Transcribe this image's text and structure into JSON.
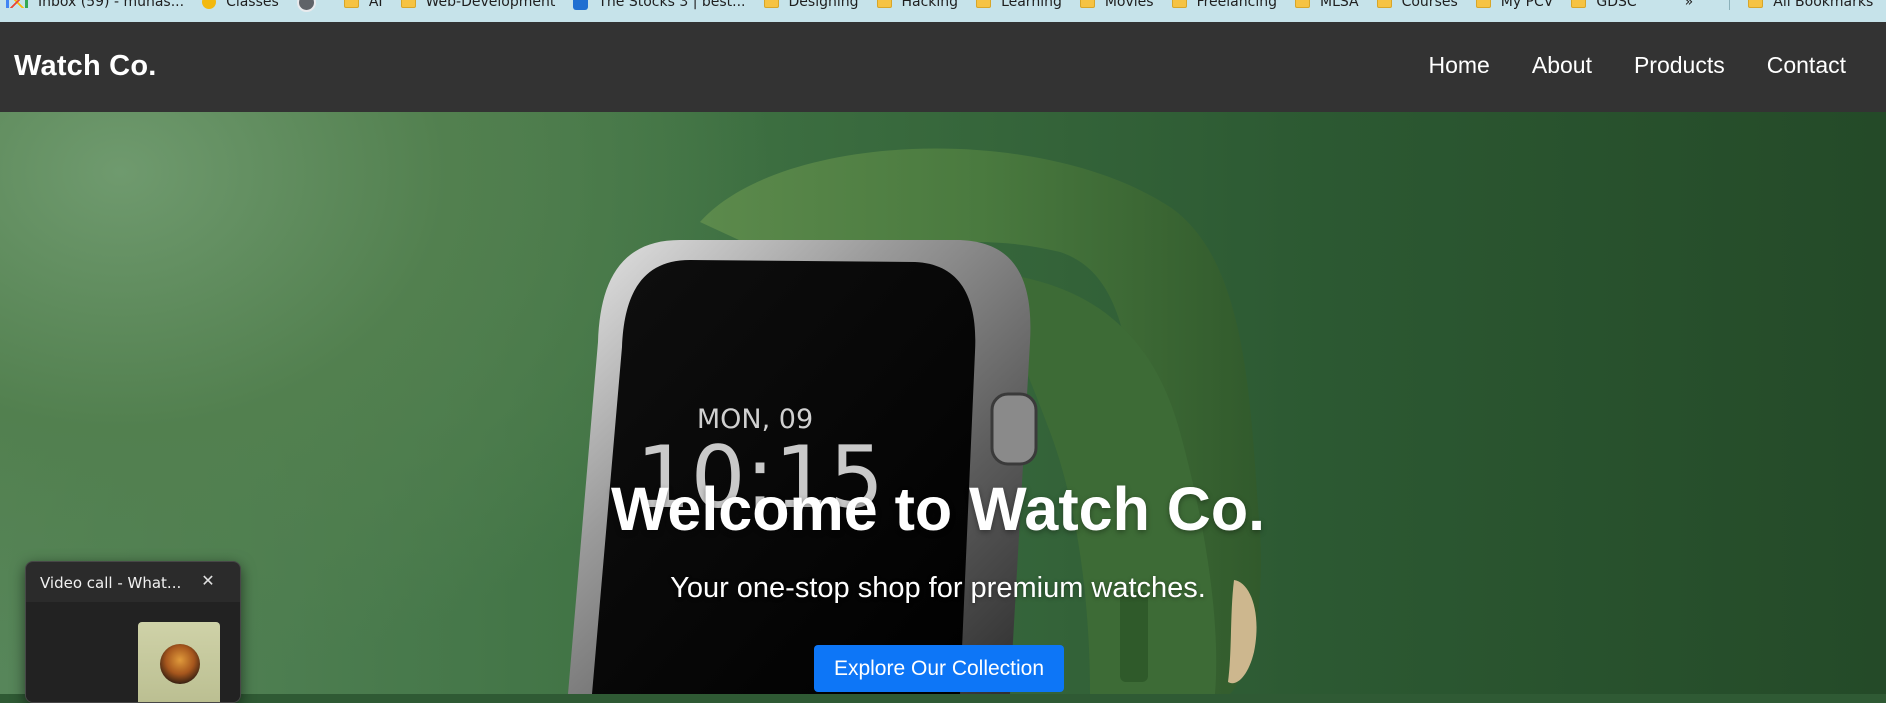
{
  "bookmarks": [
    {
      "label": "Inbox (59) - muhas...",
      "icon": "gmail-icon"
    },
    {
      "label": "Classes",
      "icon": "classes-icon"
    },
    {
      "label": "",
      "icon": "github-icon"
    },
    {
      "label": "AI",
      "icon": "folder-icon"
    },
    {
      "label": "Web-Development",
      "icon": "folder-icon"
    },
    {
      "label": "The Stocks 3 | best...",
      "icon": "stocks-icon"
    },
    {
      "label": "Designing",
      "icon": "folder-icon"
    },
    {
      "label": "Hacking",
      "icon": "folder-icon"
    },
    {
      "label": "Learning",
      "icon": "folder-icon"
    },
    {
      "label": "Movies",
      "icon": "folder-icon"
    },
    {
      "label": "Freelancing",
      "icon": "folder-icon"
    },
    {
      "label": "MLSA",
      "icon": "folder-icon"
    },
    {
      "label": "Courses",
      "icon": "folder-icon"
    },
    {
      "label": "My PCV",
      "icon": "folder-icon"
    },
    {
      "label": "GDSC",
      "icon": "folder-icon"
    }
  ],
  "bookmarks_overflow": "»",
  "all_bookmarks": "All Bookmarks",
  "header": {
    "logo": "Watch Co.",
    "nav": {
      "home": "Home",
      "about": "About",
      "products": "Products",
      "contact": "Contact"
    }
  },
  "hero": {
    "watch_date": "MON, 09",
    "watch_time": "10:15",
    "title": "Welcome to Watch Co.",
    "subtitle": "Your one-stop shop for premium watches.",
    "cta": "Explore Our Collection"
  },
  "video_call": {
    "title": "Video call - What...",
    "close": "✕"
  },
  "colors": {
    "header_bg": "#333333",
    "cta_bg": "#0d76f7",
    "bookmark_bar_bg": "#c6e3ea",
    "hero_green": "#3f7243"
  }
}
